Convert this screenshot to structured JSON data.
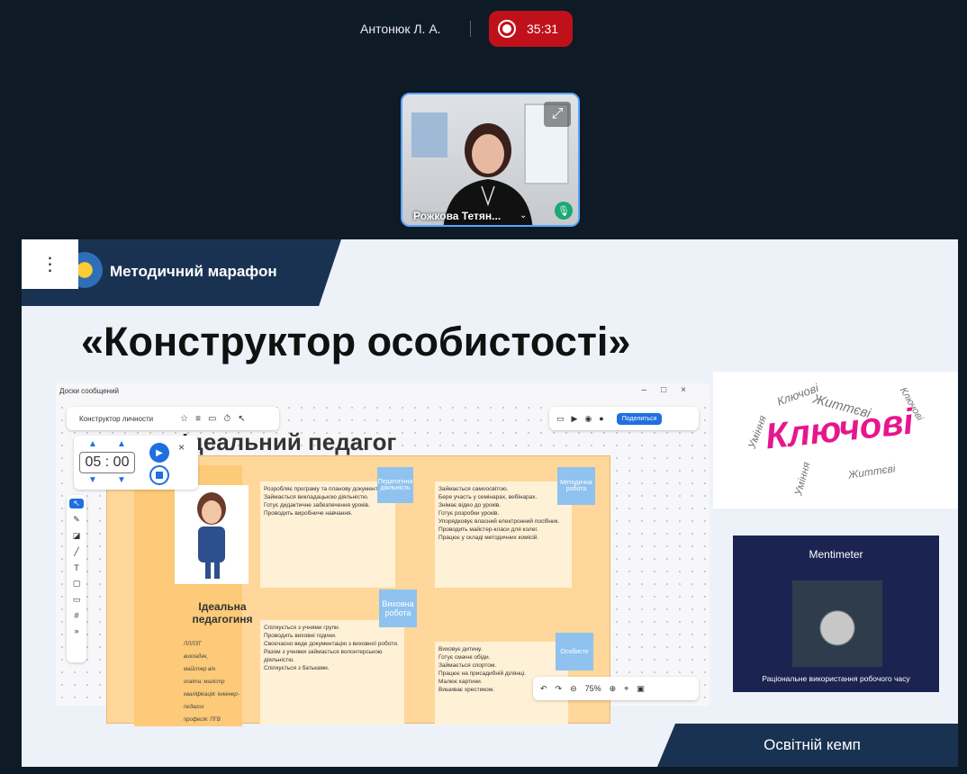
{
  "call": {
    "host_name": "Антонюк Л. А.",
    "recording_time": "35:31"
  },
  "participant": {
    "name": "Рожкова Тетян...",
    "mic_state": "mic-on-icon"
  },
  "slide": {
    "banner_title": "Методичний марафон",
    "title": "«Конструктор особистості»",
    "footer_text": "Освітній кемп",
    "board": {
      "window_title": "Доски сообщений",
      "board_name": "Конструктор личности",
      "share_label": "Поделиться",
      "zoom": "75%",
      "heading": "Ідеальний педагог",
      "timer": {
        "minutes": "05",
        "seconds": "00"
      },
      "persona": {
        "label": "Ідеальна педагогиня",
        "abbr": "ЛЛЛЗТ",
        "lines": [
          "викладач,",
          "майстер в/н",
          "освіта: магістр",
          "кваліфікація: інженер-педагог",
          "професія: ПГВ"
        ]
      },
      "stickies": {
        "pedagogical": "Педагогічна діяльність",
        "methodical": "Методична робота",
        "educational": "Виховна робота",
        "personal": "Особисте"
      },
      "cards": {
        "pedagogical": [
          "Розробляє програму та планову документацію.",
          "Займається викладацькою діяльністю.",
          "Готує дидактичне забезпечення уроків.",
          "Проводить виробниче навчання."
        ],
        "methodical": [
          "Займається самоосвітою.",
          "Бере участь у семінарах, вебінарах.",
          "Знімає відео до уроків.",
          "Готує розробки уроків.",
          "Упорядковує власний електронний посібник.",
          "Проводить майстер-класи для колег.",
          "Працює у складі методичних комісій."
        ],
        "educational": [
          "Спілкується з учнями групи.",
          "Проводить виховні години.",
          "Своєчасно веде документацію з виховної роботи.",
          "Разом з учнями займається волонтерською діяльністю.",
          "Спілкується з батьками."
        ],
        "personal": [
          "Виховує дитину.",
          "Готує смачні обіди.",
          "Займається спортом.",
          "Працює на присадибній ділянці.",
          "Малює картини.",
          "Вишиває хрестиком."
        ]
      }
    },
    "wordcloud": {
      "main_word": "Ключові",
      "words": [
        "Ключові",
        "Життєві",
        "Уміння",
        "Життєві",
        "Ключові",
        "Уміння"
      ]
    },
    "mentimeter": {
      "logo": "Mentimeter",
      "caption": "Раціональне використання робочого часу"
    }
  }
}
